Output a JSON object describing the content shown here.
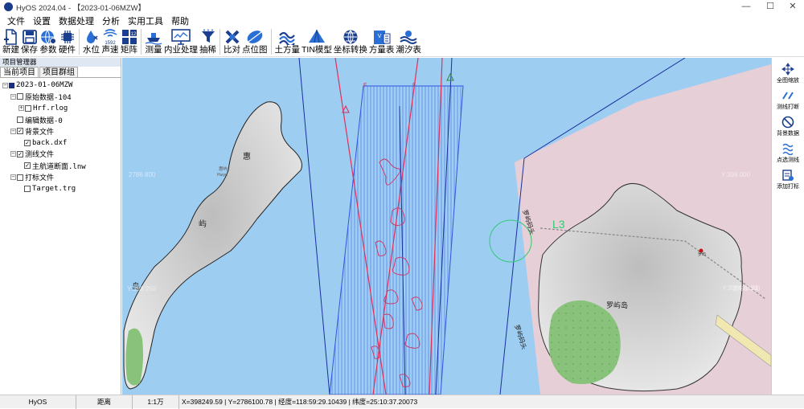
{
  "window": {
    "title": "HyOS 2024.04 - 【2023-01-06MZW】",
    "min": "—",
    "max": "☐",
    "close": "✕"
  },
  "menu": [
    "文件",
    "设置",
    "数据处理",
    "分析",
    "实用工具",
    "帮助"
  ],
  "toolbar": {
    "new": "新建",
    "save": "保存",
    "params": "参数",
    "hardware": "硬件",
    "waterlevel": "水位",
    "sound_speed": "声速",
    "sound_speed_sub": "1592",
    "matrix": "矩阵",
    "matrix_sub": "12",
    "survey": "测量",
    "processing": "内业处理",
    "thin": "抽稀",
    "compare": "比对",
    "point_map": "点位图",
    "earthwork": "土方量",
    "tin": "TIN模型",
    "coord": "坐标转换",
    "volume_table": "方量表",
    "tide_table": "潮汐表"
  },
  "left_panel": {
    "title": "项目管理器",
    "tabs": [
      "当前项目",
      "项目群组"
    ],
    "tree": {
      "root": "2023-01-06MZW",
      "raw": "原始数据-104",
      "raw_file": "Hrf.rlog",
      "edited": "编辑数据-0",
      "background": "背景文件",
      "background_file": "back.dxf",
      "survey_lines": "测线文件",
      "survey_file": "主航道断面.lnw",
      "targets": "打标文件",
      "target_file": "Target.trg"
    }
  },
  "map": {
    "island_left_labels": [
      "惠",
      "屿",
      "岛"
    ],
    "island_left_small": "惠屿",
    "island_left_pinyin": "Huiyu",
    "island_right": "罗屿岛",
    "wharf_1": "罗屿码头",
    "wharf_2": "罗屿码头",
    "marker": "L3",
    "pin_label": "罗屿",
    "line_label_f1": "F",
    "line_label_f2": "F",
    "coord_faint_1": "2786 800",
    "coord_faint_2": "Y:398 000",
    "coord_faint_3": "Y:398 250",
    "coord_faint_4": "2786 400",
    "coord_faint_5": "Y:398428.83"
  },
  "right_toolbar": [
    "全图缩放",
    "测线打断",
    "背景数据",
    "点选测线",
    "添加打标"
  ],
  "status": {
    "app": "HyOS",
    "mode": "距离",
    "scale": "1:1万",
    "coords": "X=398249.59 | Y=2786100.78 | 经度=118:59:29.10439 | 纬度=25:10:37.20073"
  },
  "colors": {
    "water": "#9ecdf2",
    "land": "#e4e4e4",
    "pink": "#f2cfd1",
    "green": "#89c27a",
    "survey_blue": "#2f55e0",
    "line_red": "#e0305a",
    "accent": "#1a3a8a"
  }
}
